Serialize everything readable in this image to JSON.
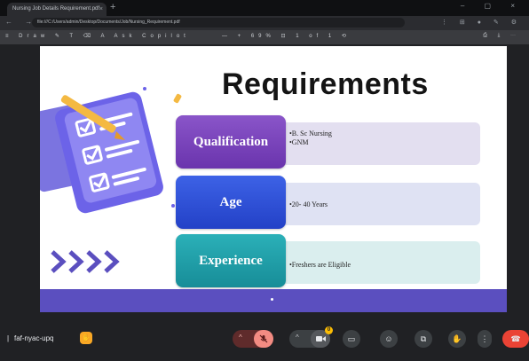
{
  "browser": {
    "tab_title": "Nursing Job Details Requirement.pdf",
    "tab_close": "×",
    "new_tab": "+",
    "window_controls": "– ▢ ×",
    "nav_controls": "← → ↻",
    "url": "file:///C:/Users/admin/Desktop/Documents/Job/Nursing_Requirement.pdf",
    "extensions": "⋮ ⊞ ● ✎ ⚙"
  },
  "pdf_toolbar": {
    "left": "≡ Draw ✎ T ⌫ A Ask Copilot",
    "middle": "— + 69% ⊡ 1 of 1 ⟲",
    "right": "⎙ ⤓ ⋯"
  },
  "slide": {
    "title": "Requirements",
    "rows": [
      {
        "label": "Qualification",
        "lines": [
          "•B. Sc Nursing",
          "•GNM"
        ]
      },
      {
        "label": "Age",
        "lines": [
          "•20- 40 Years"
        ]
      },
      {
        "label": "Experience",
        "lines": [
          "•Freshers are Eligible"
        ]
      }
    ]
  },
  "meet": {
    "meeting_code": "faf-nyac-upq",
    "participant_chip": "✋",
    "mic_caret": "^",
    "cam_caret": "^",
    "cam_badge": "0",
    "captions_icon": "▭",
    "emoji_icon": "☺",
    "present_icon": "⧉",
    "hand_icon": "✋",
    "more_icon": "⋮",
    "leave_icon": "☎"
  }
}
